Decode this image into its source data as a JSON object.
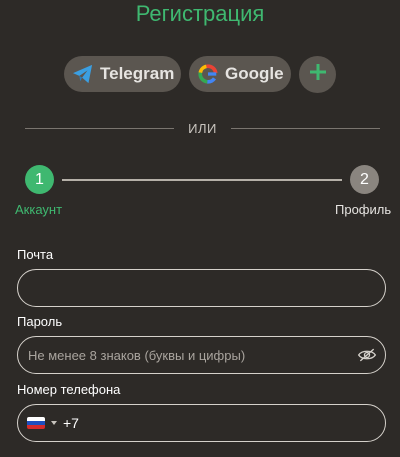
{
  "title": "Регистрация",
  "social": {
    "telegram_label": "Telegram",
    "google_label": "Google",
    "more_symbol": "+"
  },
  "divider_text": "ИЛИ",
  "steps": [
    {
      "number": "1",
      "label": "Аккаунт",
      "active": true
    },
    {
      "number": "2",
      "label": "Профиль",
      "active": false
    }
  ],
  "form": {
    "email": {
      "label": "Почта",
      "value": "",
      "placeholder": ""
    },
    "password": {
      "label": "Пароль",
      "value": "",
      "placeholder": "Не менее 8 знаков (буквы и цифры)"
    },
    "phone": {
      "label": "Номер телефона",
      "country": "RU",
      "prefix": "+7",
      "value": ""
    }
  },
  "colors": {
    "accent": "#3fb870",
    "background": "#2d2a27",
    "button_bg": "#5b5650",
    "inactive_step": "#8a857f"
  },
  "icons": {
    "telegram": "telegram-icon",
    "google": "google-icon",
    "more": "plus-icon",
    "password_toggle": "eye-slash-icon",
    "country_flag": "russia-flag-icon"
  }
}
